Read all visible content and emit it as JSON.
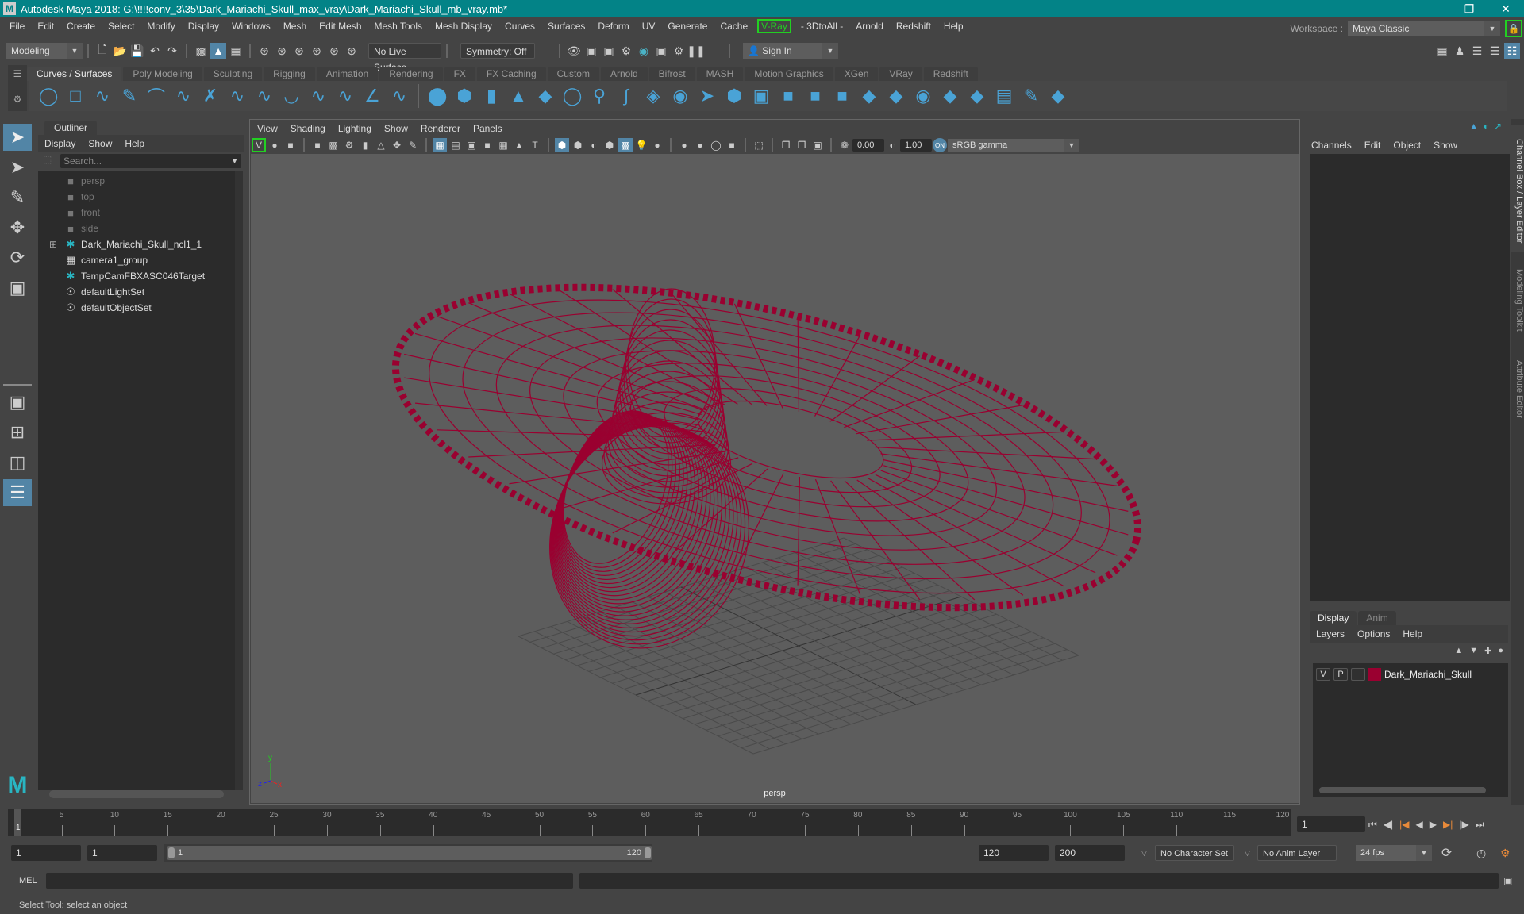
{
  "window": {
    "title": "Autodesk Maya 2018: G:\\!!!!conv_3\\35\\Dark_Mariachi_Skull_max_vray\\Dark_Mariachi_Skull_mb_vray.mb*",
    "app_icon": "maya-icon",
    "controls": [
      "minimize",
      "restore",
      "close"
    ]
  },
  "menubar": {
    "items": [
      "File",
      "Edit",
      "Create",
      "Select",
      "Modify",
      "Display",
      "Windows",
      "Mesh",
      "Edit Mesh",
      "Mesh Tools",
      "Mesh Display",
      "Curves",
      "Surfaces",
      "Deform",
      "UV",
      "Generate",
      "Cache",
      "V-Ray",
      "- 3DtoAll -",
      "Arnold",
      "Redshift",
      "Help"
    ]
  },
  "workspace": {
    "label": "Workspace :",
    "value": "Maya Classic"
  },
  "statusline": {
    "mode": "Modeling",
    "live_surface": "No Live Surface",
    "symmetry": "Symmetry: Off",
    "sign_in": "Sign In"
  },
  "shelf": {
    "tabs": [
      "Curves / Surfaces",
      "Poly Modeling",
      "Sculpting",
      "Rigging",
      "Animation",
      "Rendering",
      "FX",
      "FX Caching",
      "Custom",
      "Arnold",
      "Bifrost",
      "MASH",
      "Motion Graphics",
      "XGen",
      "VRay",
      "Redshift"
    ],
    "active_tab": "Curves / Surfaces",
    "curve_icons": [
      "circle",
      "square",
      "cv-curve",
      "pencil-curve",
      "arc",
      "ep-curve",
      "bezier",
      "curve-edit",
      "curve-extend",
      "revolve-arc",
      "cv-select",
      "curve-point",
      "intersect",
      "curve-cut"
    ],
    "surface_icons": [
      "sphere",
      "cube",
      "cylinder",
      "cone",
      "plane",
      "torus",
      "revolve",
      "loft",
      "planar",
      "extrude",
      "birail",
      "boundary",
      "square-surface",
      "bevel",
      "trim",
      "untrim",
      "attach",
      "detach",
      "intersect-surface",
      "project",
      "stitch",
      "sculpt",
      "paint",
      "rebuild"
    ]
  },
  "toolbox": {
    "tools": [
      "select-tool",
      "lasso-tool",
      "paint-select-tool",
      "move-tool",
      "rotate-tool",
      "scale-tool"
    ],
    "layouts": [
      "single-pane",
      "four-pane",
      "two-pane",
      "outliner-layout"
    ]
  },
  "outliner": {
    "title": "Outliner",
    "menu": [
      "Display",
      "Show",
      "Help"
    ],
    "search_placeholder": "Search...",
    "items": [
      {
        "name": "persp",
        "icon": "camera",
        "dim": true
      },
      {
        "name": "top",
        "icon": "camera",
        "dim": true
      },
      {
        "name": "front",
        "icon": "camera",
        "dim": true
      },
      {
        "name": "side",
        "icon": "camera",
        "dim": true
      },
      {
        "name": "Dark_Mariachi_Skull_ncl1_1",
        "icon": "locator",
        "expandable": true
      },
      {
        "name": "camera1_group",
        "icon": "group"
      },
      {
        "name": "TempCamFBXASC046Target",
        "icon": "locator"
      },
      {
        "name": "defaultLightSet",
        "icon": "set"
      },
      {
        "name": "defaultObjectSet",
        "icon": "set"
      }
    ]
  },
  "viewport": {
    "menu": [
      "View",
      "Shading",
      "Lighting",
      "Show",
      "Renderer",
      "Panels"
    ],
    "exposure": "0.00",
    "gamma": "1.00",
    "color_space": "sRGB gamma",
    "camera_label": "persp",
    "wire_color": "#9a0030",
    "axis": {
      "x": "x",
      "y": "y",
      "z": "z"
    }
  },
  "channelbox": {
    "menu": [
      "Channels",
      "Edit",
      "Object",
      "Show"
    ]
  },
  "side_tabs": [
    "Channel Box / Layer Editor",
    "Modeling Toolkit",
    "Attribute Editor"
  ],
  "layer_editor": {
    "tabs": [
      "Display",
      "Anim"
    ],
    "active_tab": "Display",
    "menu": [
      "Layers",
      "Options",
      "Help"
    ],
    "layers": [
      {
        "v": "V",
        "p": "P",
        "color": "#9a0030",
        "name": "Dark_Mariachi_Skull"
      }
    ]
  },
  "timeline": {
    "ticks": [
      5,
      10,
      15,
      20,
      25,
      30,
      35,
      40,
      45,
      50,
      55,
      60,
      65,
      70,
      75,
      80,
      85,
      90,
      95,
      100,
      105,
      110,
      115,
      120
    ],
    "start": 1,
    "end": 120,
    "current_frame": "1"
  },
  "range": {
    "start_time": "1",
    "playback_start": "1",
    "slider_start": "1",
    "slider_end": "120",
    "playback_end": "120",
    "end_time": "200",
    "character_set": "No Character Set",
    "anim_layer": "No Anim Layer",
    "fps": "24 fps"
  },
  "cmdline": {
    "label": "MEL",
    "value": ""
  },
  "helpline": {
    "text": "Select Tool: select an object"
  }
}
